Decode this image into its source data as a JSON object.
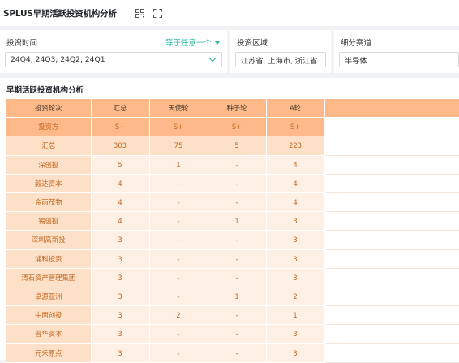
{
  "app": {
    "title": "SPLUS早期活跃投资机构分析"
  },
  "toolbar": {
    "icons": [
      "qr-grid-icon",
      "fullscreen-icon"
    ]
  },
  "filters": {
    "time": {
      "label": "投资时间",
      "operator": "等于任意一个",
      "value": "24Q4, 24Q3, 24Q2, 24Q1"
    },
    "region": {
      "label": "投资区域",
      "value": "江苏省, 上海市, 浙江省"
    },
    "track": {
      "label": "细分赛道",
      "value": "半导体"
    }
  },
  "section": {
    "title": "早期活跃投资机构分析"
  },
  "table": {
    "header_row1": [
      "投资轮次",
      "汇总",
      "天使轮",
      "种子轮",
      "A轮"
    ],
    "header_row2": [
      "投资方",
      "S+",
      "S+",
      "S+",
      "S+"
    ],
    "total": {
      "label": "汇总",
      "values": [
        "303",
        "75",
        "5",
        "223"
      ]
    },
    "rows": [
      {
        "label": "深创投",
        "values": [
          "5",
          "1",
          "-",
          "4"
        ]
      },
      {
        "label": "毅达资本",
        "values": [
          "4",
          "-",
          "-",
          "4"
        ]
      },
      {
        "label": "金雨茂物",
        "values": [
          "4",
          "-",
          "-",
          "4"
        ]
      },
      {
        "label": "锡创投",
        "values": [
          "4",
          "-",
          "1",
          "3"
        ]
      },
      {
        "label": "深圳高新投",
        "values": [
          "3",
          "-",
          "-",
          "3"
        ]
      },
      {
        "label": "浦科投资",
        "values": [
          "3",
          "-",
          "-",
          "3"
        ]
      },
      {
        "label": "清石资产管理集团",
        "values": [
          "3",
          "-",
          "-",
          "3"
        ]
      },
      {
        "label": "卓源亚洲",
        "values": [
          "3",
          "-",
          "1",
          "2"
        ]
      },
      {
        "label": "中南创投",
        "values": [
          "3",
          "2",
          "-",
          "1"
        ]
      },
      {
        "label": "普华资本",
        "values": [
          "3",
          "-",
          "-",
          "3"
        ]
      },
      {
        "label": "元禾原点",
        "values": [
          "3",
          "-",
          "-",
          "3"
        ]
      }
    ]
  },
  "colors": {
    "accent": "#2db7a3",
    "header": "#fdb98a",
    "label_cell": "#fde0c8",
    "value_cell": "#fef0e4",
    "value_text": "#c1661f"
  }
}
